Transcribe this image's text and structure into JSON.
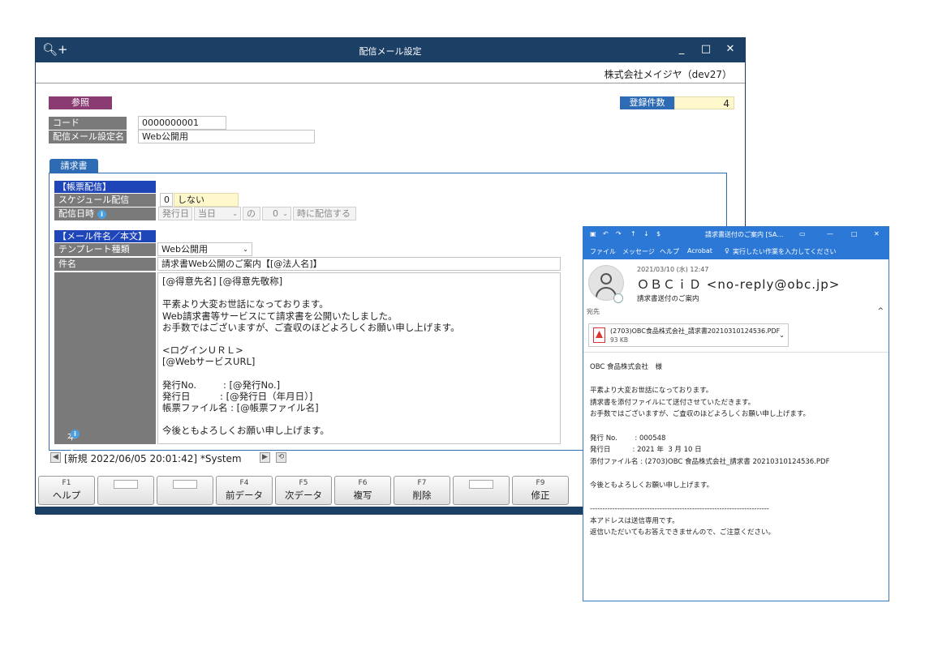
{
  "main_window": {
    "title": "配信メール設定",
    "company": "株式会社メイジヤ（dev27）",
    "mode": "参照",
    "count_label": "登録件数",
    "count_value": "4",
    "code_label": "コード",
    "code_value": "0000000001",
    "name_label": "配信メール設定名",
    "name_value": "Web公開用",
    "tab": "請求書",
    "section_delivery": "【帳票配信】",
    "schedule_label": "スケジュール配信",
    "schedule_code": "0",
    "schedule_value": "しない",
    "datetime_label": "配信日時",
    "dt_issue": "発行日",
    "dt_day": "当日",
    "dt_no": "の",
    "dt_hour": "0",
    "dt_suffix": "時に配信する",
    "section_mail": "【メール件名／本文】",
    "template_label": "テンプレート種類",
    "template_value": "Web公開用",
    "subject_label": "件名",
    "subject_value": "請求書Web公開のご案内【[@法人名]】",
    "body_label": "本文",
    "body_lines": [
      "[@得意先名] [@得意先敬称]",
      "",
      "平素より大変お世話になっております。",
      "Web請求書等サービスにて請求書を公開いたしました。",
      "お手数ではございますが、ご査収のほどよろしくお願い申し上げます。",
      "",
      "<ログインＵＲＬ>",
      "[@WebサービスURL]",
      "",
      "発行No.         : [@発行No.]",
      "発行日          : [@発行日（年月日）]",
      "帳票ファイル名 : [@帳票ファイル名]",
      "",
      "今後ともよろしくお願い申し上げます。"
    ],
    "status": "[新規 2022/06/05 20:01:42] *System",
    "fkeys": [
      {
        "key": "F1",
        "label": "ヘルプ"
      },
      {
        "key": "",
        "label": ""
      },
      {
        "key": "",
        "label": ""
      },
      {
        "key": "F4",
        "label": "前データ"
      },
      {
        "key": "F5",
        "label": "次データ"
      },
      {
        "key": "F6",
        "label": "複写"
      },
      {
        "key": "F7",
        "label": "削除"
      },
      {
        "key": "",
        "label": ""
      },
      {
        "key": "F9",
        "label": "修正"
      }
    ]
  },
  "email_window": {
    "title": "請求書送付のご案内 [SA…",
    "ribbon": [
      "ファイル",
      "メッセージ",
      "ヘルプ",
      "Acrobat",
      "実行したい作業を入力してください"
    ],
    "date": "2021/03/10 (水) 12:47",
    "from": "ＯＢＣｉＤ <no-reply@obc.jp>",
    "subject": "請求書送付のご案内",
    "to_label": "宛先",
    "attachment_name": "(2703)OBC食品株式会社_請求書20210310124536.PDF",
    "attachment_size": "93 KB",
    "body_lines": [
      "OBC 食品株式会社　様",
      "",
      "平素より大変お世話になっております。",
      "請求書を添付ファイルにて送付させていただきます。",
      "お手数ではございますが、ご査収のほどよろしくお願い申し上げます。",
      "",
      "発行 No.        : 000548",
      "発行日          : 2021 年  3 月 10 日",
      "添付ファイル名 : (2703)OBC 食品株式会社_請求書 20210310124536.PDF",
      "",
      "今後ともよろしくお願い申し上げます。",
      "",
      "------------------------------------------------------------------------",
      "本アドレスは送信専用です。",
      "返信いただいてもお答えできませんので、ご注意ください。"
    ]
  }
}
